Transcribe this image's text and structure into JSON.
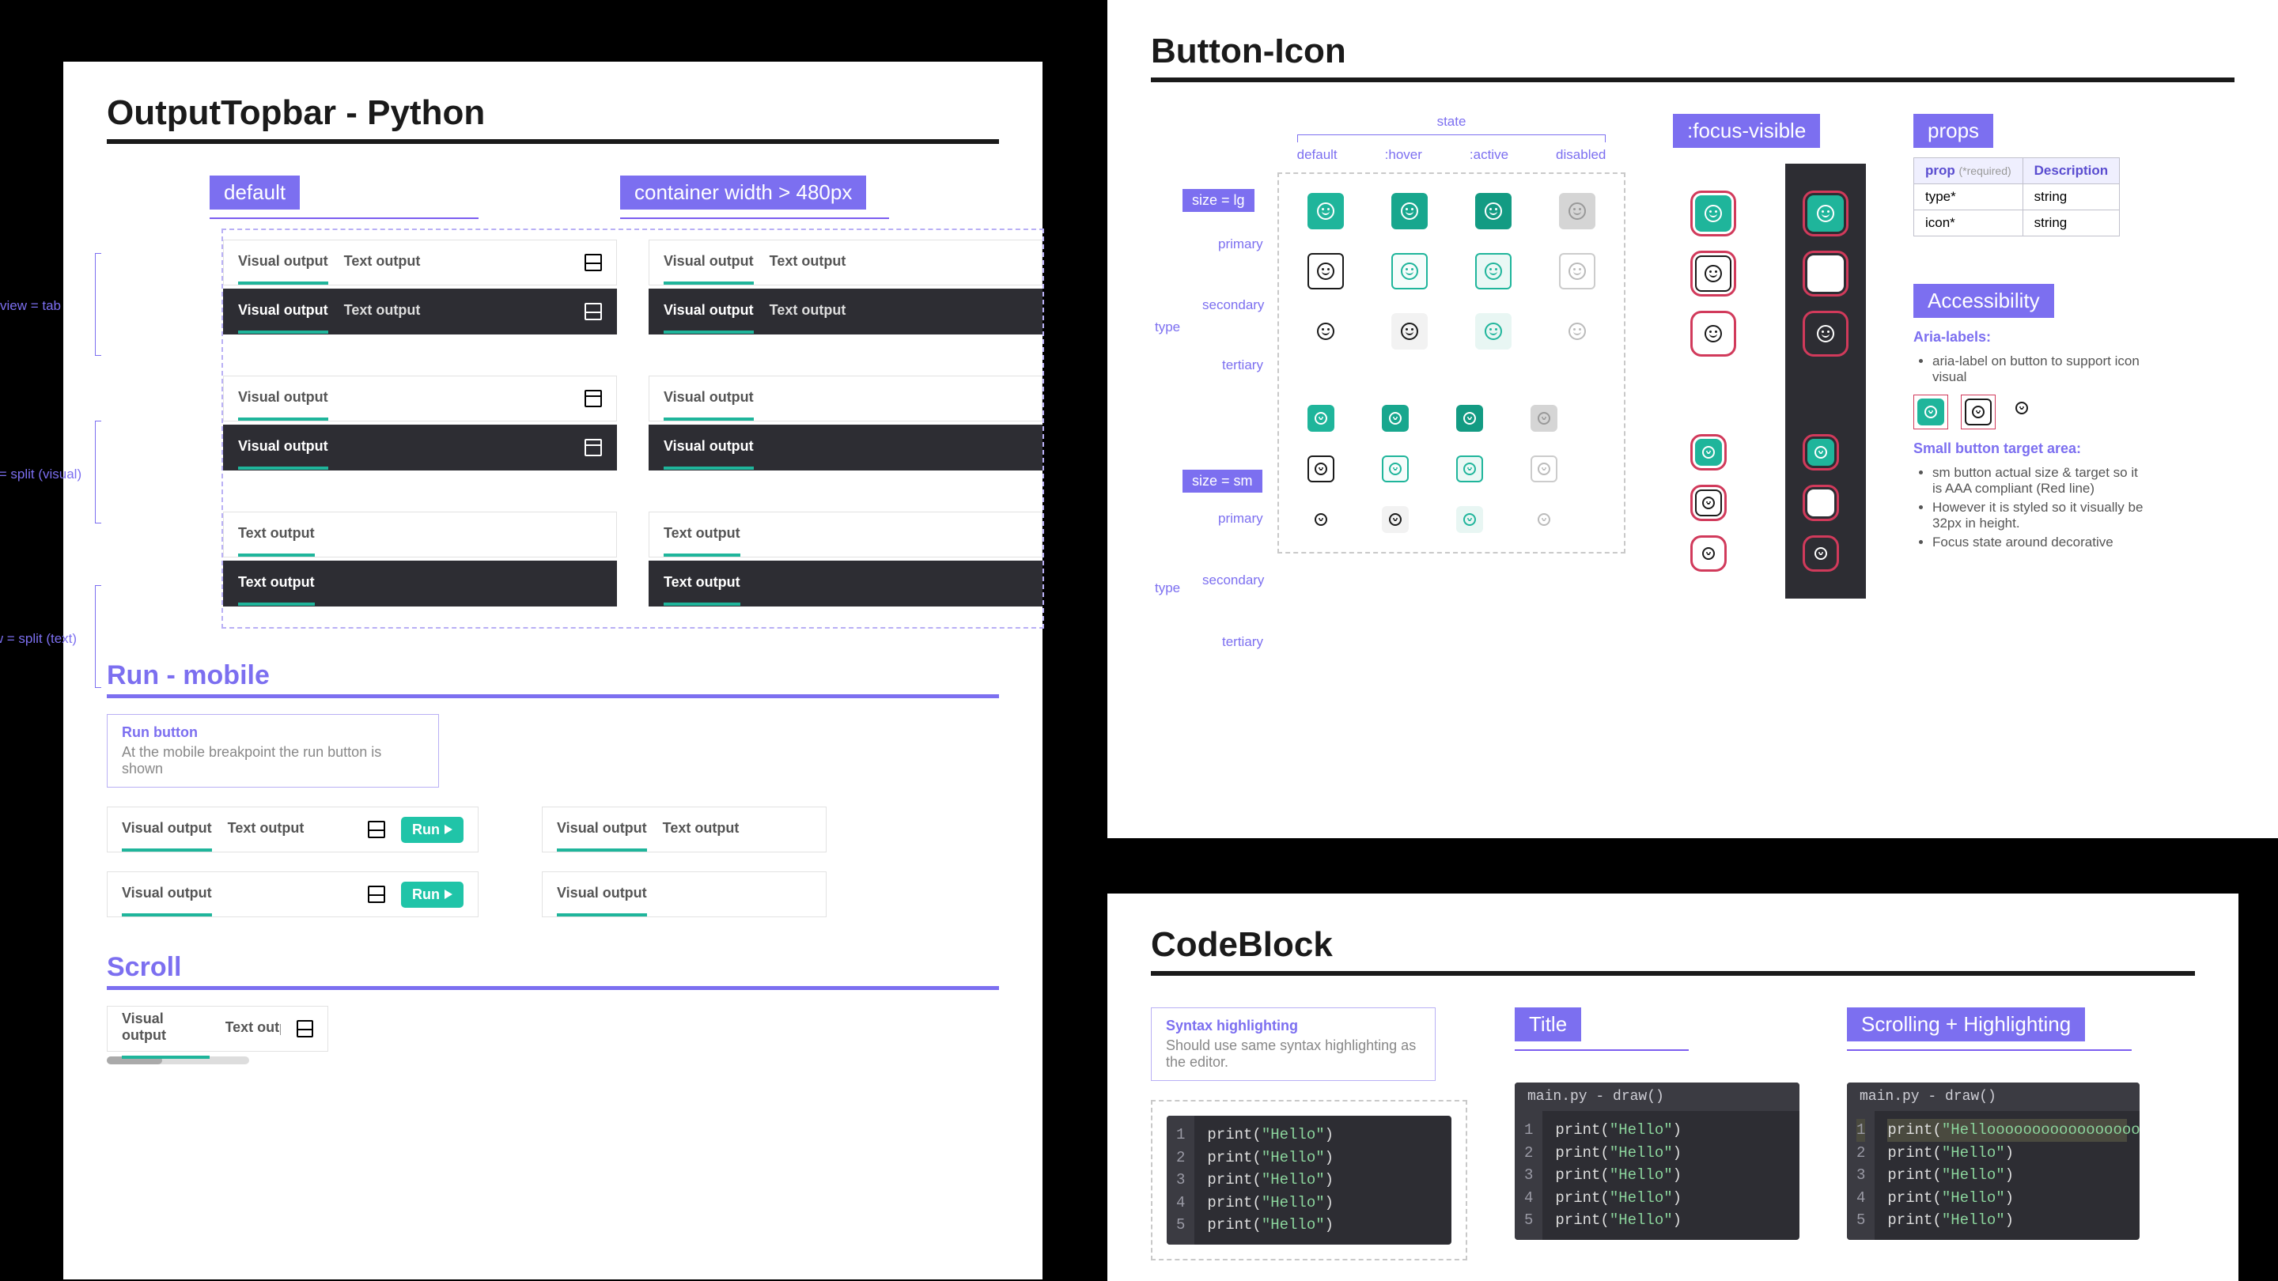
{
  "panels": {
    "outputTopbar": {
      "title": "OutputTopbar - Python",
      "cols": {
        "default": "default",
        "wide": "container width > 480px"
      },
      "rowLabels": {
        "tab": "view = tab",
        "splitVisual": "view = split (visual)",
        "splitText": "view = split (text)"
      },
      "tabs": {
        "visual": "Visual output",
        "text": "Text output"
      },
      "runMobile": {
        "heading": "Run - mobile",
        "noteTitle": "Run button",
        "noteText": "At the mobile breakpoint the run button is shown",
        "runLabel": "Run"
      },
      "scroll": {
        "heading": "Scroll"
      }
    },
    "buttonIcon": {
      "title": "Button-Icon",
      "stateGroup": "state",
      "states": [
        "default",
        ":hover",
        ":active",
        "disabled"
      ],
      "sizeLg": "size = lg",
      "sizeSm": "size = sm",
      "typeGroup": "type",
      "types": [
        "primary",
        "secondary",
        "tertiary"
      ],
      "focusVisible": ":focus-visible",
      "propsHeading": "props",
      "propsTable": {
        "head": {
          "prop": "prop",
          "required": "(*required)",
          "desc": "Description"
        },
        "rows": [
          {
            "name": "type*",
            "desc": "string"
          },
          {
            "name": "icon*",
            "desc": "string"
          }
        ]
      },
      "accessibility": {
        "heading": "Accessibility",
        "ariaHead": "Aria-labels:",
        "ariaItems": [
          "aria-label on button to support icon visual"
        ],
        "targetHead": "Small button target area:",
        "targetItems": [
          "sm button actual size & target so it is AAA compliant (Red line)",
          "However it is styled so it visually be 32px in height.",
          "Focus state around decorative"
        ]
      }
    },
    "codeBlock": {
      "title": "CodeBlock",
      "noteTitle": "Syntax highlighting",
      "noteText": "Should use same syntax highlighting as the editor.",
      "titleTag": "Title",
      "scrollTag": "Scrolling + Highlighting",
      "fileTitle": "main.py - draw()",
      "lines": [
        "print(\"Hello\")",
        "print(\"Hello\")",
        "print(\"Hello\")",
        "print(\"Hello\")",
        "print(\"Hello\")"
      ],
      "longLine": "print(\"Hellooooooooooooooooo\")"
    }
  }
}
